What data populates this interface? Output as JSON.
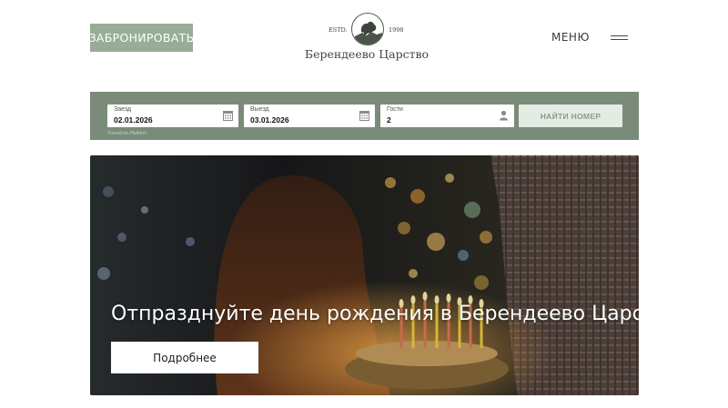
{
  "header": {
    "book_label": "ЗАБРОНИРОВАТЬ",
    "logo": {
      "estd": "ESTD.",
      "year": "1998",
      "name": "Берендеево Царство"
    },
    "menu_label": "МЕНЮ"
  },
  "booking": {
    "checkin": {
      "label": "Заезд",
      "value": "02.01.2026",
      "icon": "calendar-icon"
    },
    "checkout": {
      "label": "Выезд",
      "value": "03.01.2026",
      "icon": "calendar-icon"
    },
    "guests": {
      "label": "Гости",
      "value": "2",
      "icon": "person-icon"
    },
    "search_label": "НАЙТИ НОМЕР",
    "powered_by": "TravelLine Platform"
  },
  "hero": {
    "title": "Отпразднуйте день рождения в Берендеево Царство",
    "button_label": "Подробнее"
  },
  "colors": {
    "accent": "#98ad98",
    "booking_bar": "#7a8c79",
    "search_button": "#e3ebe3"
  }
}
